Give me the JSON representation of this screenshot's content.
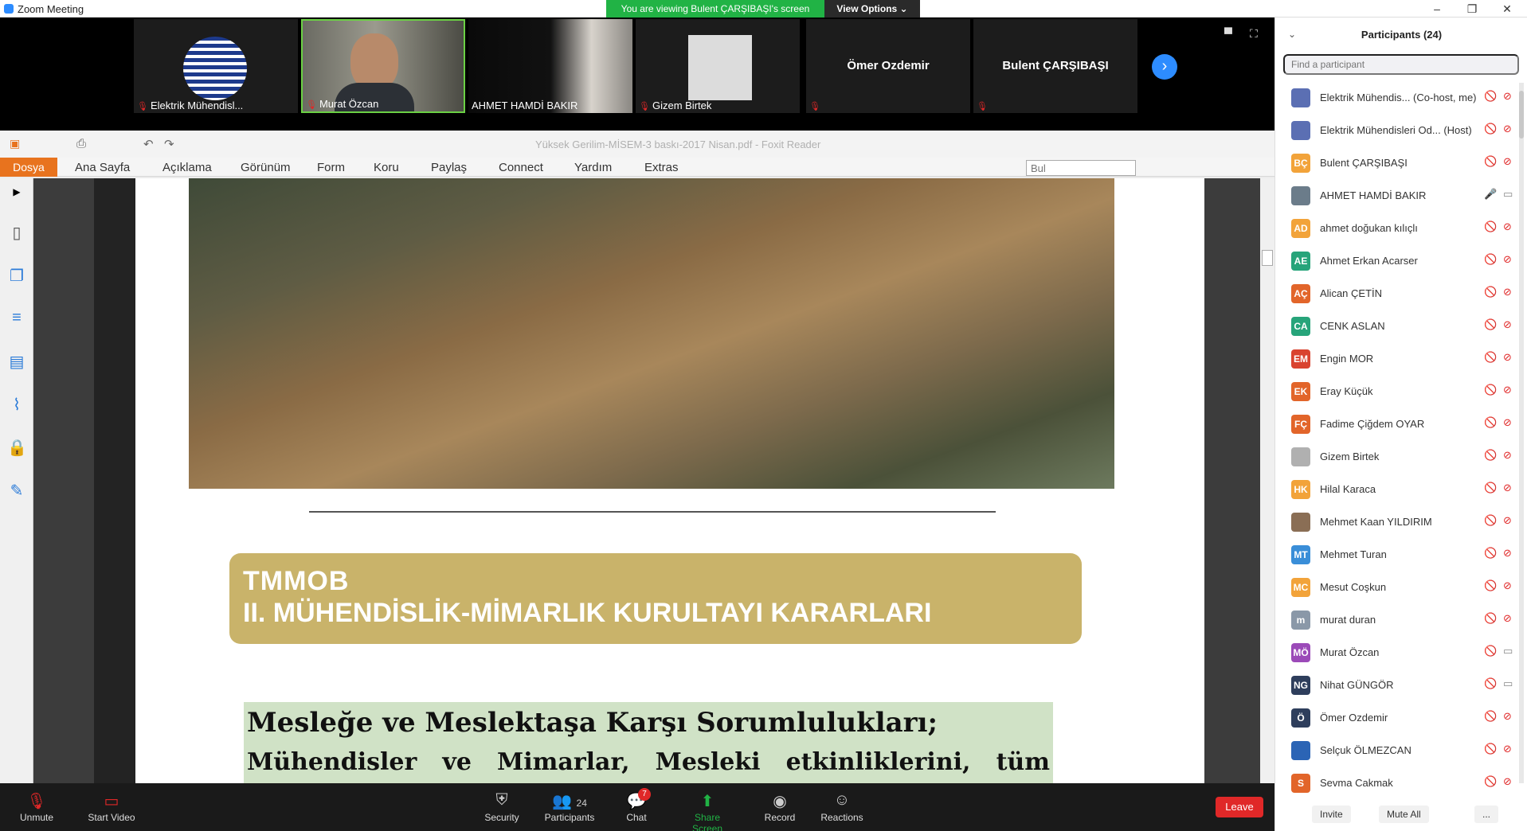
{
  "window": {
    "title": "Zoom Meeting",
    "minimize": "–",
    "restore": "❐",
    "close": "✕"
  },
  "banner": {
    "viewing": "You are viewing Bulent ÇARŞIBAŞI's screen",
    "view_options": "View Options ⌄"
  },
  "gallery": {
    "tiles": [
      {
        "name": "Elektrik Mühendisl...",
        "muted": true
      },
      {
        "name": "Murat Özcan",
        "muted": true
      },
      {
        "name": "AHMET HAMDİ BAKIR",
        "muted": false
      },
      {
        "name": "Gizem Birtek",
        "muted": true
      },
      {
        "name": "Ömer Ozdemir",
        "muted": true
      },
      {
        "name": "Bulent ÇARŞIBAŞI",
        "muted": true
      }
    ],
    "next": "›"
  },
  "foxit": {
    "title": "Yüksek Gerilim-MİSEM-3 baskı-2017 Nisan.pdf - Foxit Reader",
    "menu": [
      "Dosya",
      "Ana Sayfa",
      "Açıklama",
      "Görünüm",
      "Form",
      "Koru",
      "Paylaş",
      "Connect",
      "Yardım",
      "Extras"
    ],
    "search_placeholder": "Bul"
  },
  "document": {
    "banner_line1": "TMMOB",
    "banner_line2": "II. MÜHENDİSLİK-MİMARLIK KURULTAYI KARARLARI",
    "heading": "Mesleğe ve Meslektaşa Karşı Sorumlulukları;",
    "para_words": [
      "Mühendisler",
      "ve",
      "Mimarlar,",
      "Mesleki",
      "etkinliklerini,",
      "tüm"
    ]
  },
  "toolbar": {
    "unmute": "Unmute",
    "start_video": "Start Video",
    "security": "Security",
    "participants": "Participants",
    "participants_count": "24",
    "chat": "Chat",
    "chat_badge": "7",
    "share": "Share Screen",
    "record": "Record",
    "reactions": "Reactions",
    "leave": "Leave"
  },
  "panel": {
    "title": "Participants (24)",
    "search_placeholder": "Find a participant",
    "participants": [
      {
        "initials": "",
        "name": "Elektrik Mühendis... (Co-host, me)",
        "color": "#5b6fb3",
        "mic": "muted",
        "video": "off"
      },
      {
        "initials": "",
        "name": "Elektrik Mühendisleri Od... (Host)",
        "color": "#5b6fb3",
        "mic": "muted",
        "video": "off"
      },
      {
        "initials": "BÇ",
        "name": "Bulent ÇARŞIBAŞI",
        "color": "#f2a33a",
        "mic": "muted",
        "video": "off"
      },
      {
        "initials": "",
        "name": "AHMET HAMDİ BAKIR",
        "color": "#6b7c8a",
        "mic": "on",
        "video": "on"
      },
      {
        "initials": "AD",
        "name": "ahmet doğukan kılıçlı",
        "color": "#f2a33a",
        "mic": "muted",
        "video": "off"
      },
      {
        "initials": "AE",
        "name": "Ahmet Erkan Acarser",
        "color": "#27a47a",
        "mic": "muted",
        "video": "off"
      },
      {
        "initials": "AÇ",
        "name": "Alican ÇETİN",
        "color": "#e2652a",
        "mic": "muted",
        "video": "off"
      },
      {
        "initials": "CA",
        "name": "CENK ASLAN",
        "color": "#27a47a",
        "mic": "muted",
        "video": "off"
      },
      {
        "initials": "EM",
        "name": "Engin MOR",
        "color": "#d9432f",
        "mic": "muted",
        "video": "off"
      },
      {
        "initials": "EK",
        "name": "Eray Küçük",
        "color": "#e2652a",
        "mic": "muted",
        "video": "off"
      },
      {
        "initials": "FÇ",
        "name": "Fadime Çiğdem OYAR",
        "color": "#e2652a",
        "mic": "muted",
        "video": "off"
      },
      {
        "initials": "",
        "name": "Gizem Birtek",
        "color": "#b0b0b0",
        "mic": "muted",
        "video": "off"
      },
      {
        "initials": "HK",
        "name": "Hilal Karaca",
        "color": "#f2a33a",
        "mic": "muted",
        "video": "off"
      },
      {
        "initials": "",
        "name": "Mehmet Kaan YILDIRIM",
        "color": "#8a6e55",
        "mic": "muted",
        "video": "off"
      },
      {
        "initials": "MT",
        "name": "Mehmet Turan",
        "color": "#3a8ed8",
        "mic": "muted",
        "video": "off"
      },
      {
        "initials": "MC",
        "name": "Mesut Coşkun",
        "color": "#f2a33a",
        "mic": "muted",
        "video": "off"
      },
      {
        "initials": "m",
        "name": "murat duran",
        "color": "#8a98a8",
        "mic": "muted",
        "video": "off"
      },
      {
        "initials": "MÖ",
        "name": "Murat Özcan",
        "color": "#9b4ab8",
        "mic": "muted",
        "video": "on"
      },
      {
        "initials": "NG",
        "name": "Nihat GÜNGÖR",
        "color": "#2e3e5c",
        "mic": "muted",
        "video": "on"
      },
      {
        "initials": "Ö",
        "name": "Ömer Ozdemir",
        "color": "#2e3e5c",
        "mic": "muted",
        "video": "off"
      },
      {
        "initials": "",
        "name": "Selçuk ÖLMEZCAN",
        "color": "#2b64b5",
        "mic": "muted",
        "video": "off"
      },
      {
        "initials": "S",
        "name": "Sevma Cakmak",
        "color": "#e2652a",
        "mic": "muted",
        "video": "off"
      }
    ],
    "invite": "Invite",
    "mute_all": "Mute All",
    "more": "..."
  }
}
